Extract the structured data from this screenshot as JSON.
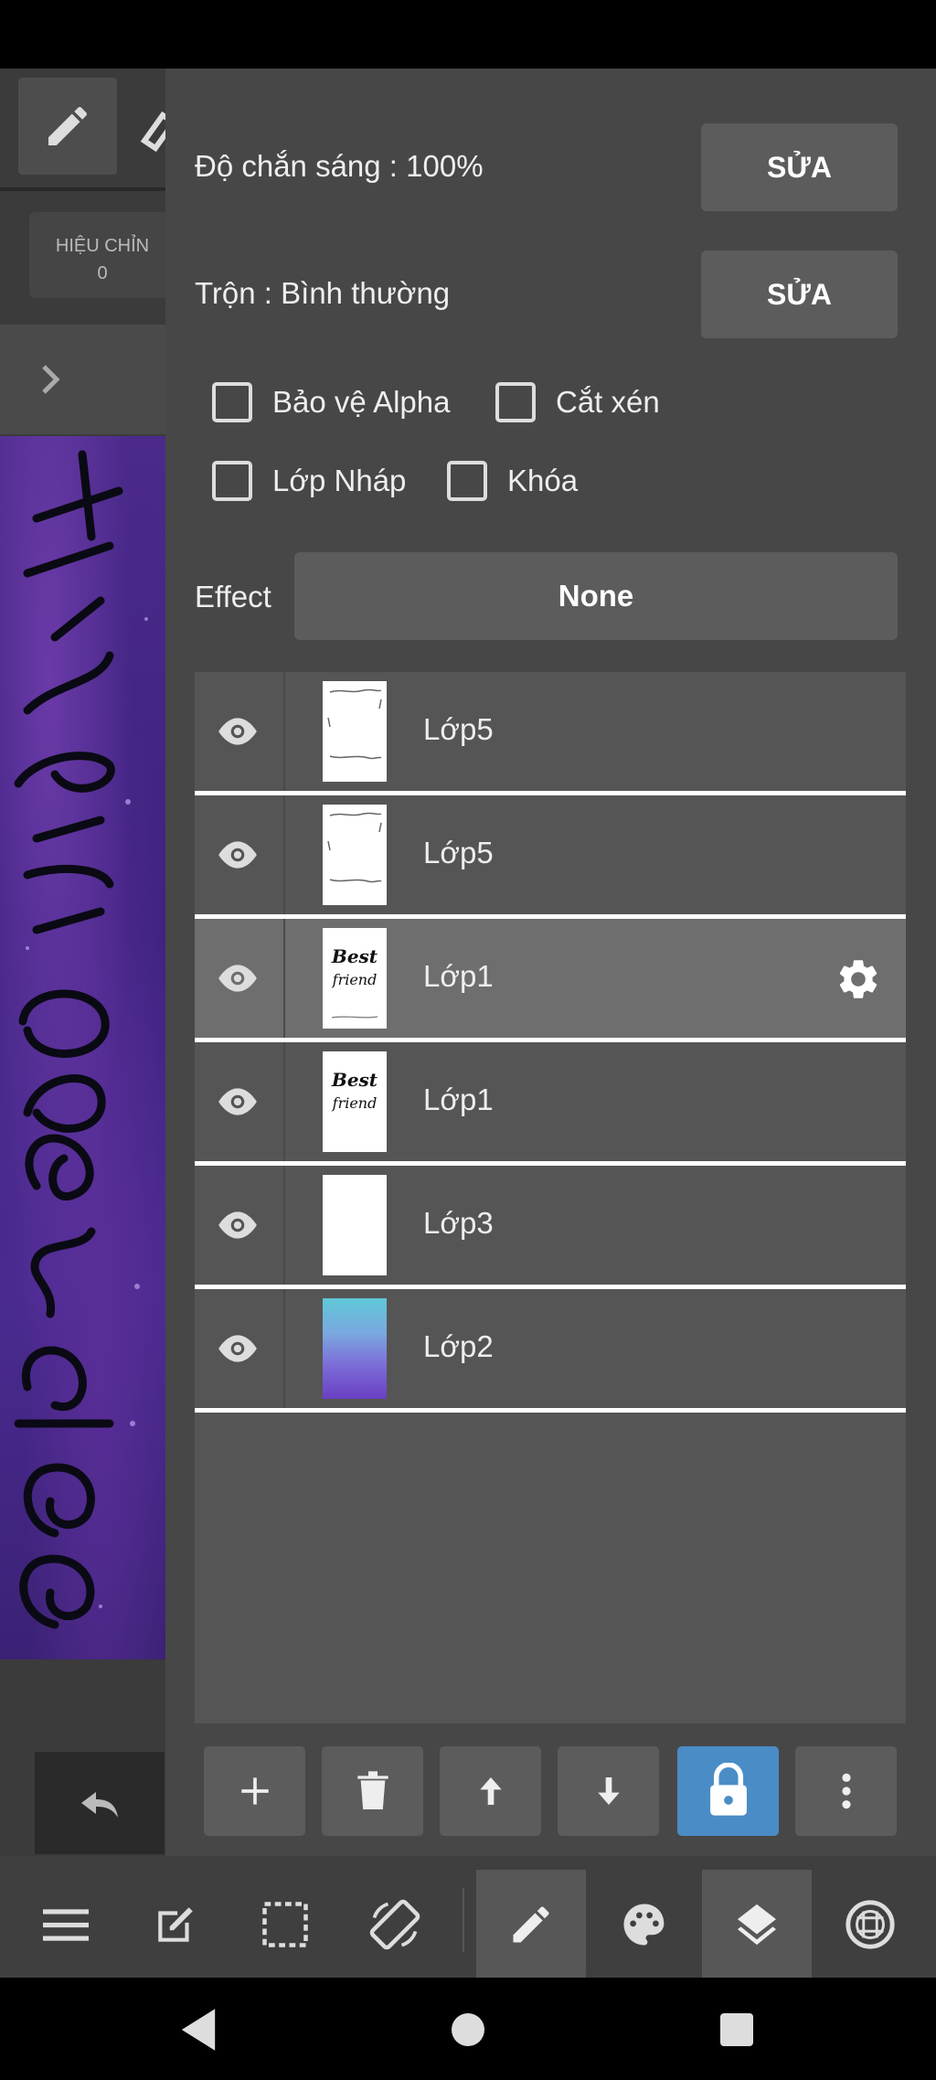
{
  "left_strip": {
    "correction_label": "HIỆU CHỈN",
    "correction_value": "0"
  },
  "panel": {
    "opacity_label": "Độ chắn sáng : 100%",
    "opacity_edit": "SỬA",
    "blend_label": "Trộn : Bình thường",
    "blend_edit": "SỬA",
    "checkboxes": [
      {
        "label": "Bảo vệ Alpha",
        "checked": false
      },
      {
        "label": "Cắt xén",
        "checked": false
      },
      {
        "label": "Lớp Nháp",
        "checked": false
      },
      {
        "label": "Khóa",
        "checked": false
      }
    ],
    "effect_label": "Effect",
    "effect_value": "None"
  },
  "layers": [
    {
      "name": "Lớp5",
      "visible": true,
      "selected": false,
      "thumb": "white-with-leaf-border"
    },
    {
      "name": "Lớp5",
      "visible": true,
      "selected": false,
      "thumb": "white-with-leaf-border"
    },
    {
      "name": "Lớp1",
      "visible": true,
      "selected": true,
      "thumb": "best-friend-text"
    },
    {
      "name": "Lớp1",
      "visible": true,
      "selected": false,
      "thumb": "best-friend-text"
    },
    {
      "name": "Lớp3",
      "visible": true,
      "selected": false,
      "thumb": "plain-white"
    },
    {
      "name": "Lớp2",
      "visible": true,
      "selected": false,
      "thumb": "watercolor-gradient"
    }
  ],
  "thumb_text": {
    "best": "Best",
    "friend": "friend"
  },
  "layer_actions": [
    "add-layer",
    "delete-layer",
    "move-layer-up",
    "move-layer-down",
    "lock-layer",
    "more-options"
  ],
  "toolbar": [
    "menu",
    "edit",
    "selection",
    "rotate-canvas",
    "brush",
    "palette",
    "layers",
    "material"
  ],
  "colors": {
    "panel_bg": "#474747",
    "button_bg": "#5c5c5c",
    "list_bg": "#555555",
    "selected_row": "#6e6e6e",
    "lock_accent": "#4a8dc6"
  }
}
